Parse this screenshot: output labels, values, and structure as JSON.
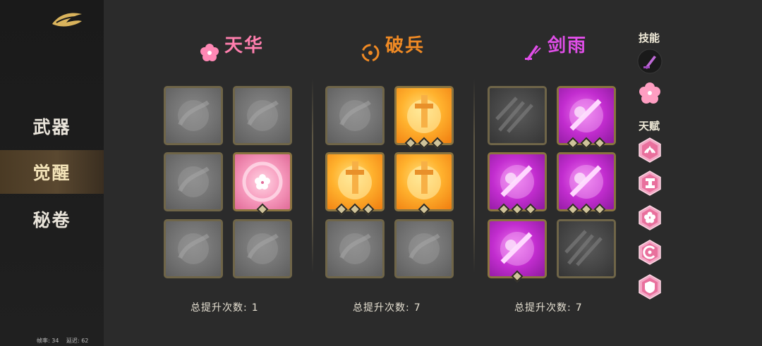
{
  "sidebar": {
    "items": [
      {
        "label": "武器"
      },
      {
        "label": "觉醒"
      },
      {
        "label": "秘卷"
      }
    ],
    "active_index": 1
  },
  "perf": {
    "fps": "帧率: 34",
    "latency": "延迟: 62"
  },
  "columns": [
    {
      "title": "天华",
      "title_color": "#ff7fae",
      "total_label": "总提升次数:",
      "total_value": "1",
      "cells": [
        {
          "style": "locked",
          "diamonds": 0
        },
        {
          "style": "locked",
          "diamonds": 0
        },
        {
          "style": "locked",
          "diamonds": 0
        },
        {
          "style": "pink",
          "diamonds": 1
        },
        {
          "style": "locked",
          "diamonds": 0
        },
        {
          "style": "locked",
          "diamonds": 0
        }
      ]
    },
    {
      "title": "破兵",
      "title_color": "#f08a24",
      "total_label": "总提升次数:",
      "total_value": "7",
      "cells": [
        {
          "style": "locked",
          "diamonds": 0
        },
        {
          "style": "fire",
          "diamonds": 3
        },
        {
          "style": "fire",
          "diamonds": 3
        },
        {
          "style": "fire",
          "diamonds": 1
        },
        {
          "style": "locked",
          "diamonds": 0
        },
        {
          "style": "locked",
          "diamonds": 0
        }
      ]
    },
    {
      "title": "剑雨",
      "title_color": "#e04ee8",
      "total_label": "总提升次数:",
      "total_value": "7",
      "cells": [
        {
          "style": "dark",
          "diamonds": 0
        },
        {
          "style": "magenta",
          "diamonds": 3
        },
        {
          "style": "magenta",
          "diamonds": 3
        },
        {
          "style": "magenta",
          "diamonds": 3
        },
        {
          "style": "magenta",
          "diamonds": 1
        },
        {
          "style": "dark",
          "diamonds": 0
        }
      ]
    }
  ],
  "right_panel": {
    "skills_label": "技能",
    "talents_label": "天赋",
    "skill_icons": [
      "sword-skill-icon",
      "blossom-skill-icon"
    ],
    "talent_icons": [
      "fan-talent-icon",
      "hammer-talent-icon",
      "flower-talent-icon",
      "swirl-talent-icon",
      "shield-talent-icon"
    ]
  },
  "colors": {
    "background": "#2b2b2b",
    "sidebar": "#1c1c1c",
    "active_nav": "#5a4830",
    "diamond": "#cfc39a",
    "talent_hex": "#f3a6c4"
  }
}
